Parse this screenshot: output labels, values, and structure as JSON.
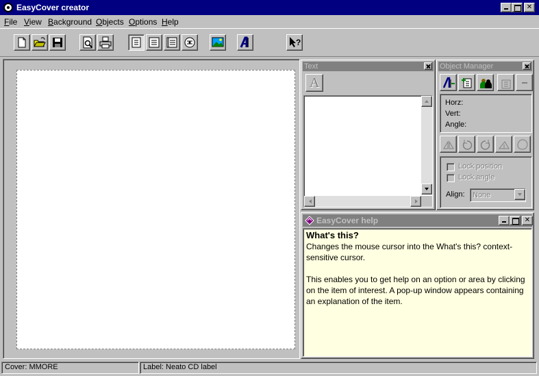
{
  "window": {
    "title": "EasyCover creator"
  },
  "menu": [
    "File",
    "View",
    "Background",
    "Objects",
    "Options",
    "Help"
  ],
  "toolbar": {
    "buttons": [
      "new-icon",
      "open-icon",
      "save-icon",
      "print-preview-icon",
      "print-icon",
      "front-cover-icon",
      "inlay-icon",
      "back-cover-icon",
      "cd-label-icon",
      "background-image-icon",
      "text-object-icon",
      "whats-this-icon"
    ],
    "pressed": "front-cover-icon"
  },
  "text_panel": {
    "title": "Text",
    "font_button_glyph": "A"
  },
  "object_manager": {
    "title": "Object Manager",
    "horz_label": "Horz:",
    "vert_label": "Vert:",
    "angle_label": "Angle:",
    "lock_position": "Lock position",
    "lock_angle": "Lock angle",
    "align_label": "Align:",
    "align_value": "None"
  },
  "help": {
    "title": "EasyCover help",
    "heading": "What's this?",
    "paragraph1": "Changes the mouse cursor into the What's this? context-sensitive cursor.",
    "paragraph2": "This enables you to get help on an option or area by clicking on the item of interest. A pop-up window appears containing an explanation of the item."
  },
  "status": {
    "cover": "Cover:  MMORE",
    "label": "Label:  Neato CD label"
  },
  "colors": {
    "titlebar": "#000080",
    "face": "#c0c0c0",
    "help_bg": "#ffffe1",
    "inactive_title": "#808080"
  }
}
